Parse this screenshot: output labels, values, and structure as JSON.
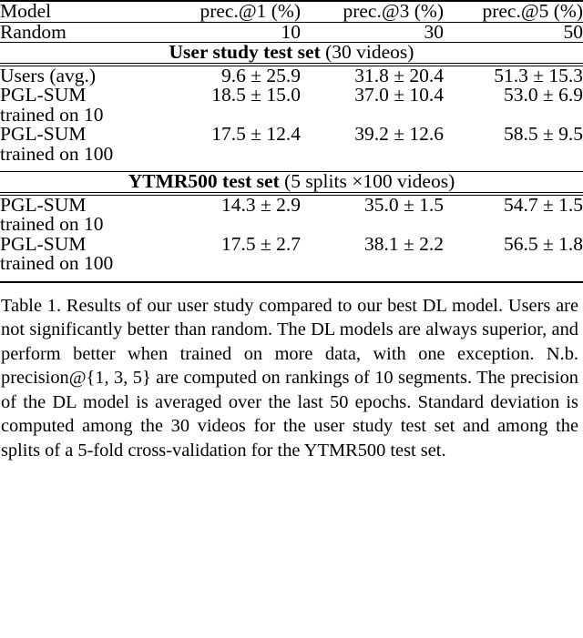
{
  "table": {
    "columns": [
      "Model",
      "prec.@1 (%)",
      "prec.@3 (%)",
      "prec.@5 (%)"
    ],
    "random_row": {
      "label": "Random",
      "p1": "10",
      "p3": "30",
      "p5": "50"
    },
    "sections": [
      {
        "title_bold": "User study test set",
        "title_rest": "(30 videos)",
        "rows": [
          {
            "label": "Users (avg.)",
            "label2": "",
            "p1": "9.6 ± 25.9",
            "p1_bold": false,
            "p3": "31.8 ± 20.4",
            "p3_bold": false,
            "p5": "51.3 ± 15.3",
            "p5_bold": false
          },
          {
            "label": "PGL-SUM",
            "label2": "trained on 10",
            "p1": "18.5 ± 15.0",
            "p1_bold": true,
            "p3": "37.0 ± 10.4",
            "p3_bold": false,
            "p5": "53.0 ± 6.9",
            "p5_bold": false
          },
          {
            "label": "PGL-SUM",
            "label2": "trained on 100",
            "p1": "17.5 ± 12.4",
            "p1_bold": false,
            "p3": "39.2 ± 12.6",
            "p3_bold": true,
            "p5": "58.5 ± 9.5",
            "p5_bold": true
          }
        ]
      },
      {
        "title_bold": "YTMR500 test set",
        "title_rest": "(5 splits ×100 videos)",
        "rows": [
          {
            "label": "PGL-SUM",
            "label2": "trained on 10",
            "p1": "14.3 ± 2.9",
            "p1_bold": false,
            "p3": "35.0 ± 1.5",
            "p3_bold": false,
            "p5": "54.7 ± 1.5",
            "p5_bold": false
          },
          {
            "label": "PGL-SUM",
            "label2": "trained on 100",
            "p1": "17.5 ± 2.7",
            "p1_bold": true,
            "p3": "38.1 ± 2.2",
            "p3_bold": true,
            "p5": "56.5 ± 1.8",
            "p5_bold": true
          }
        ]
      }
    ]
  },
  "caption": {
    "text": "Table 1. Results of our user study compared to our best DL model. Users are not significantly better than random. The DL models are always superior, and perform better when trained on more data, with one exception. N.b. precision@{1, 3, 5} are computed on rankings of 10 segments. The precision of the DL model is averaged over the last 50 epochs. Standard deviation is computed among the 30 videos for the user study test set and among the splits of a 5-fold cross-validation for the YTMR500 test set."
  }
}
